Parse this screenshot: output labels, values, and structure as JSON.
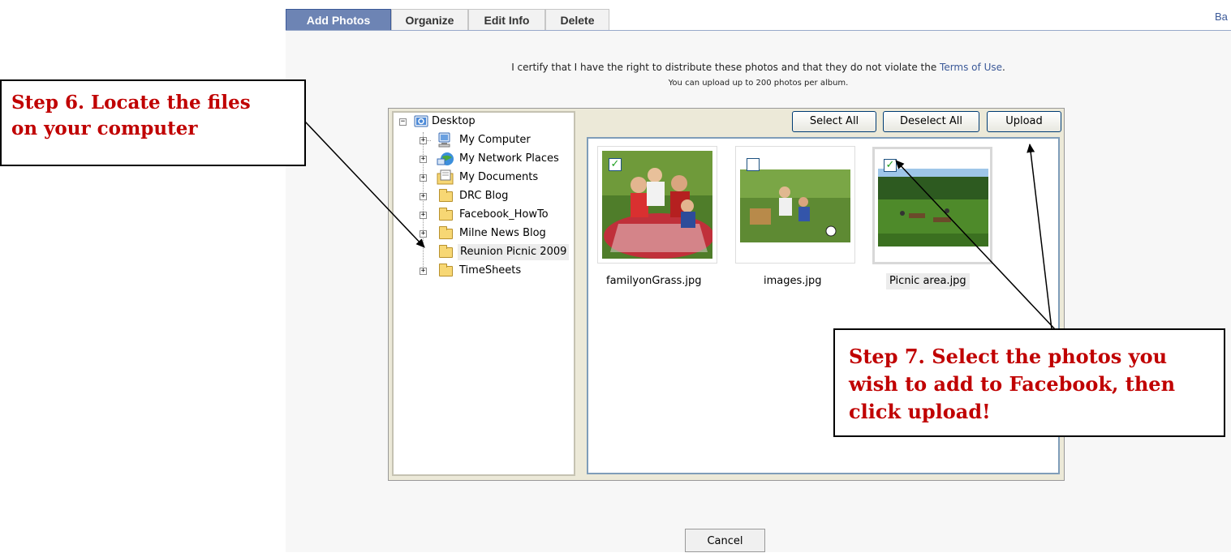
{
  "tabs": [
    {
      "label": "Add Photos",
      "active": true
    },
    {
      "label": "Organize",
      "active": false
    },
    {
      "label": "Edit Info",
      "active": false
    },
    {
      "label": "Delete",
      "active": false
    }
  ],
  "back_link": "Ba",
  "certify": {
    "prefix": "I certify that I have the right to distribute these photos and that they do not violate the ",
    "link": "Terms of Use",
    "suffix": "."
  },
  "upload_limit": "You can upload up to 200 photos per album.",
  "tree": {
    "root": "Desktop",
    "items": [
      {
        "label": "My Computer",
        "icon": "computer-icon"
      },
      {
        "label": "My Network Places",
        "icon": "network-places-icon"
      },
      {
        "label": "My Documents",
        "icon": "documents-icon"
      },
      {
        "label": "DRC Blog",
        "icon": "folder-icon"
      },
      {
        "label": "Facebook_HowTo",
        "icon": "folder-icon"
      },
      {
        "label": "Milne News Blog",
        "icon": "folder-icon"
      },
      {
        "label": "Reunion Picnic 2009",
        "icon": "folder-icon",
        "selected": true
      },
      {
        "label": "TimeSheets",
        "icon": "folder-icon"
      }
    ]
  },
  "buttons": {
    "select_all": "Select All",
    "deselect_all": "Deselect All",
    "upload": "Upload",
    "cancel": "Cancel"
  },
  "photos": [
    {
      "filename": "familyonGrass.jpg",
      "checked": true
    },
    {
      "filename": "images.jpg",
      "checked": false
    },
    {
      "filename": "Picnic area.jpg",
      "checked": true
    }
  ],
  "callouts": {
    "step6_line1": "Step 6. Locate the files",
    "step6_line2": "on your computer",
    "step7_line1": "Step 7. Select the photos you",
    "step7_line2": "wish to add to Facebook, then",
    "step7_line3": "click upload!"
  },
  "colors": {
    "tab_active": "#6d84b4",
    "link": "#3b5998",
    "callout_text": "#c00000"
  }
}
